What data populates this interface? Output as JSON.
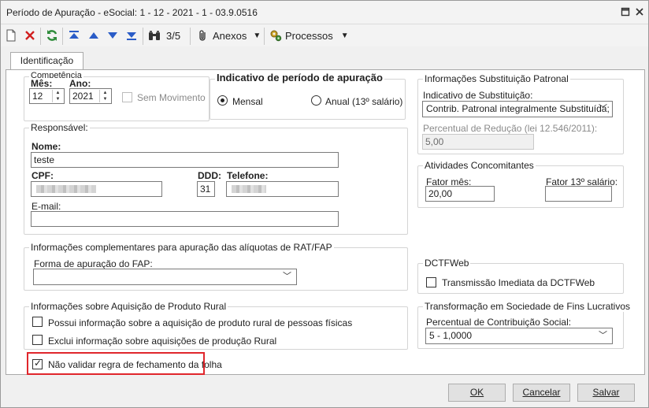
{
  "window": {
    "title": "Período de Apuração - eSocial: 1 - 12 - 2021 - 1 - 03.9.0516"
  },
  "toolbar": {
    "record_counter": "3/5",
    "anexos_label": "Anexos",
    "processos_label": "Processos"
  },
  "tabs": [
    {
      "label": "Identificação"
    }
  ],
  "competencia": {
    "group_title": "Competência",
    "mes_label": "Mês:",
    "mes_value": "12",
    "ano_label": "Ano:",
    "ano_value": "2021",
    "sem_movimento_label": "Sem Movimento",
    "sem_movimento_checked": false
  },
  "indicativo_periodo": {
    "title": "Indicativo de período de apuração",
    "options": [
      {
        "label": "Mensal",
        "selected": true
      },
      {
        "label": "Anual (13º salário)",
        "selected": false
      }
    ]
  },
  "responsavel": {
    "group_title": "Responsável:",
    "nome_label": "Nome:",
    "nome_value": "teste",
    "cpf_label": "CPF:",
    "ddd_label": "DDD:",
    "ddd_value": "31",
    "telefone_label": "Telefone:",
    "email_label": "E-mail:",
    "email_value": ""
  },
  "substituicao_patronal": {
    "group_title": "Informações Substituição Patronal",
    "indicativo_label": "Indicativo de Substituição:",
    "indicativo_value": "Contrib. Patronal integralmente Substituída;",
    "percentual_label": "Percentual de Redução  (lei 12.546/2011):",
    "percentual_value": "5,00"
  },
  "atividades_concomitantes": {
    "group_title": "Atividades Concomitantes",
    "fator_mes_label": "Fator mês:",
    "fator_mes_value": "20,00",
    "fator_13_label": "Fator 13º salário:",
    "fator_13_value": ""
  },
  "rat_fap": {
    "group_title": "Informações complementares para apuração das alíquotas de RAT/FAP",
    "forma_label": "Forma de apuração do FAP:",
    "forma_value": ""
  },
  "dctfweb": {
    "group_title": "DCTFWeb",
    "transmissao_label": "Transmissão Imediata da DCTFWeb",
    "transmissao_checked": false
  },
  "produto_rural": {
    "group_title": "Informações sobre Aquisição de Produto Rural",
    "possui_label": "Possui informação sobre a aquisição de produto rural de pessoas físicas",
    "exclui_label": "Exclui informação sobre aquisições de produção Rural"
  },
  "nao_validar": {
    "label": "Não validar regra de fechamento da folha",
    "checked": true
  },
  "transformacao": {
    "group_title": "Transformação em Sociedade de Fins Lucrativos",
    "percentual_label": "Percentual de Contribuição Social:",
    "percentual_value": "5 - 1,0000"
  },
  "footer": {
    "ok_label": "OK",
    "cancelar_label": "Cancelar",
    "salvar_label": "Salvar"
  },
  "colors": {
    "highlight": "#e0262c",
    "accent_blue": "#2a5cc7",
    "green": "#2e8b3a",
    "red": "#d11f1f"
  }
}
